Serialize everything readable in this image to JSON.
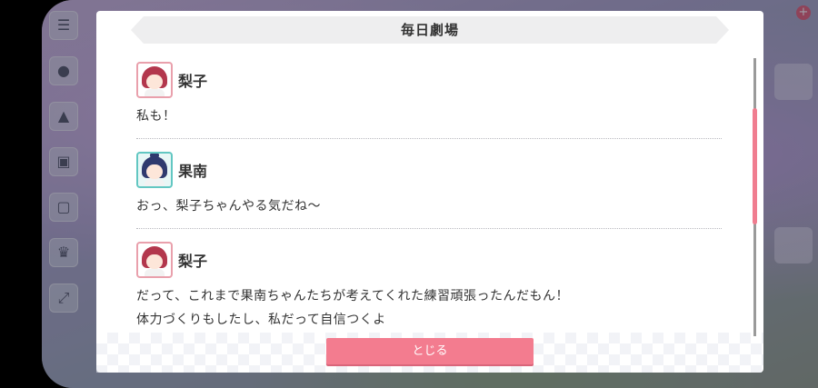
{
  "dialog": {
    "title": "毎日劇場",
    "close_label": "とじる"
  },
  "log": [
    {
      "speaker": "梨子",
      "avatar": "riko-avatar",
      "lines": [
        "私も！"
      ]
    },
    {
      "speaker": "果南",
      "avatar": "kanan-avatar",
      "lines": [
        "おっ、梨子ちゃんやる気だね〜"
      ]
    },
    {
      "speaker": "梨子",
      "avatar": "riko-avatar",
      "lines": [
        "だって、これまで果南ちゃんたちが考えてくれた練習頑張ったんだもん！",
        "体力づくりもしたし、私だって自信つくよ"
      ]
    }
  ],
  "background": {
    "side_icons": [
      "menu-icon",
      "chat-icon",
      "present-icon",
      "gift-icon",
      "screen-icon",
      "trophy-icon",
      "expand-icon"
    ],
    "badge": "+"
  },
  "colors": {
    "accent": "#f37c8f",
    "scroll_thumb": "#f07d90",
    "riko_frame": "#e9a0ac",
    "kanan_frame": "#62c7c2"
  }
}
